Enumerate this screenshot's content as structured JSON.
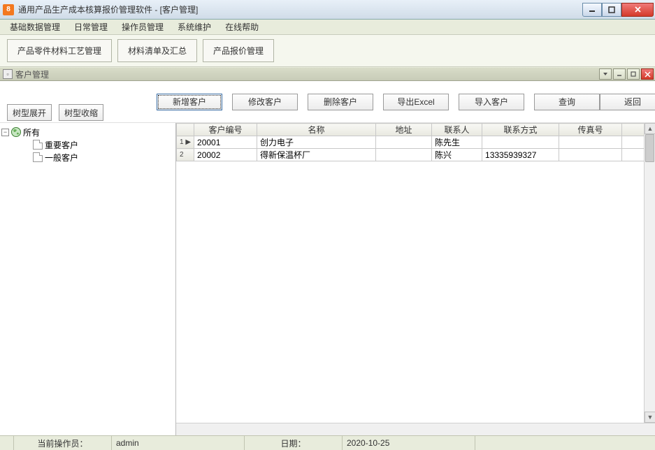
{
  "window_title": "通用产品生产成本核算报价管理软件  - [客户管理]",
  "menus": [
    "基础数据管理",
    "日常管理",
    "操作员管理",
    "系统维护",
    "在线帮助"
  ],
  "big_toolbar": {
    "b1": "产品零件材料工艺管理",
    "b2": "材料清单及汇总",
    "b3": "产品报价管理"
  },
  "mdi_title": "客户管理",
  "actions": {
    "new": "新增客户",
    "edit": "修改客户",
    "delete": "删除客户",
    "export": "导出Excel",
    "import": "导入客户",
    "search": "查询",
    "back": "返回"
  },
  "tree_buttons": {
    "expand": "树型展开",
    "collapse": "树型收缩"
  },
  "tree": {
    "root": "所有",
    "children": [
      "重要客户",
      "一般客户"
    ]
  },
  "grid": {
    "columns": [
      "客户编号",
      "名称",
      "地址",
      "联系人",
      "联系方式",
      "传真号"
    ],
    "rows": [
      {
        "row_no": "1",
        "selector": "▶",
        "id": "20001",
        "name": "创力电子",
        "addr": "",
        "contact": "陈先生",
        "phone": "",
        "fax": ""
      },
      {
        "row_no": "2",
        "selector": "",
        "id": "20002",
        "name": "得新保温杯厂",
        "addr": "",
        "contact": "陈兴",
        "phone": "13335939327",
        "fax": ""
      }
    ]
  },
  "status": {
    "operator_label": "当前操作员：",
    "operator_value": "admin",
    "date_label": "日期：",
    "date_value": "2020-10-25"
  }
}
